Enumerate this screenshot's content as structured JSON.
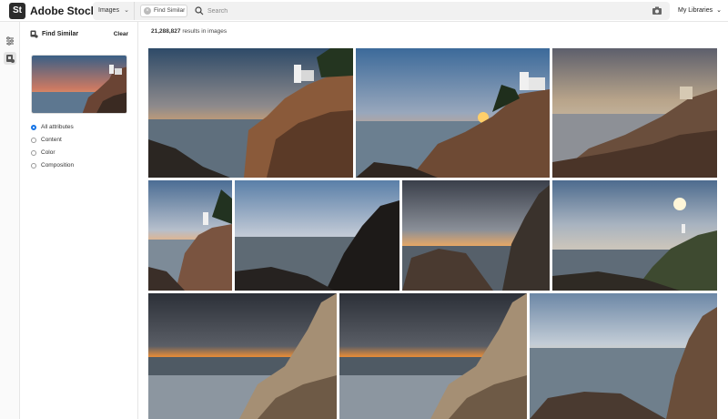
{
  "app": {
    "logo_text": "St",
    "brand": "Adobe Stock"
  },
  "search": {
    "asset_type": "Images",
    "chip_label": "Find Similar",
    "placeholder": "Search",
    "value": ""
  },
  "header": {
    "libraries_label": "My Libraries"
  },
  "panel": {
    "title": "Find Similar",
    "clear_label": "Clear",
    "options": [
      {
        "label": "All attributes",
        "selected": true
      },
      {
        "label": "Content",
        "selected": false
      },
      {
        "label": "Color",
        "selected": false
      },
      {
        "label": "Composition",
        "selected": false
      }
    ]
  },
  "main": {
    "results_count": "21,288,827",
    "results_text": "results in images"
  },
  "icons": [
    "filter-icon",
    "find-similar-icon",
    "search-icon",
    "camera-icon",
    "chevron-down-icon",
    "close-icon"
  ],
  "colors": {
    "accent": "#1473e6",
    "logo_bg": "#2c2c2c"
  }
}
